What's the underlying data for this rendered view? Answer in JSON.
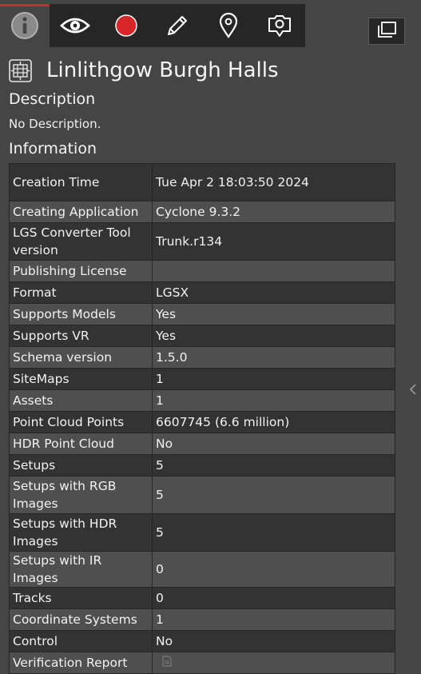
{
  "colors": {
    "accent": "#d9262b",
    "panel_bg": "#454545",
    "toolbar_bg": "#262626"
  },
  "toolbar": {
    "tabs": [
      {
        "icon": "info-icon"
      },
      {
        "icon": "eye-icon"
      },
      {
        "icon": "record-icon",
        "color": "#d9262b"
      },
      {
        "icon": "pencil-icon"
      },
      {
        "icon": "map-pin-icon"
      },
      {
        "icon": "camera-icon"
      }
    ],
    "window_icon": "restore-window-icon"
  },
  "header": {
    "title": "Linlithgow Burgh Halls",
    "icon": "building-icon"
  },
  "description": {
    "heading": "Description",
    "text": "No Description."
  },
  "information": {
    "heading": "Information",
    "rows": [
      {
        "label": "Creation Time",
        "value": "Tue Apr 2 18:03:50 2024"
      },
      {
        "label": "Creating Application",
        "value": "Cyclone 9.3.2"
      },
      {
        "label": "LGS Converter Tool version",
        "value": "Trunk.r134"
      },
      {
        "label": "Publishing License",
        "value": ""
      },
      {
        "label": "Format",
        "value": "LGSX"
      },
      {
        "label": "Supports Models",
        "value": "Yes"
      },
      {
        "label": "Supports VR",
        "value": "Yes"
      },
      {
        "label": "Schema version",
        "value": "1.5.0"
      },
      {
        "label": "SiteMaps",
        "value": "1"
      },
      {
        "label": "Assets",
        "value": "1"
      },
      {
        "label": "Point Cloud Points",
        "value": "6607745 (6.6 million)"
      },
      {
        "label": "HDR Point Cloud",
        "value": "No"
      },
      {
        "label": "Setups",
        "value": "5"
      },
      {
        "label": "Setups with RGB Images",
        "value": "5"
      },
      {
        "label": "Setups with HDR Images",
        "value": "5"
      },
      {
        "label": "Setups with IR Images",
        "value": "0"
      },
      {
        "label": "Tracks",
        "value": "0"
      },
      {
        "label": "Coordinate Systems",
        "value": "1"
      },
      {
        "label": "Control",
        "value": "No"
      },
      {
        "label": "Verification Report",
        "value": "",
        "icon": "document-icon"
      }
    ]
  }
}
